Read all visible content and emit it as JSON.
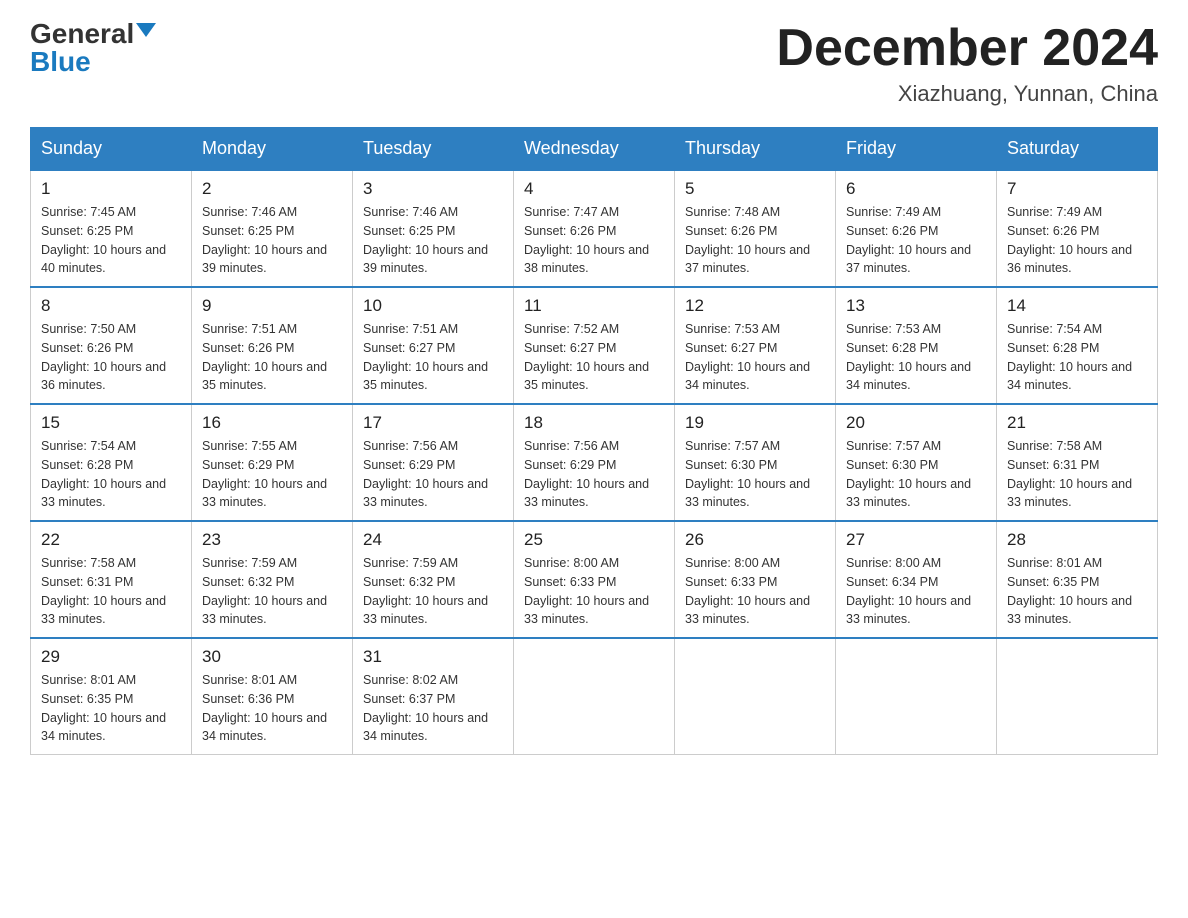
{
  "logo": {
    "general": "General",
    "blue": "Blue"
  },
  "title": "December 2024",
  "location": "Xiazhuang, Yunnan, China",
  "headers": [
    "Sunday",
    "Monday",
    "Tuesday",
    "Wednesday",
    "Thursday",
    "Friday",
    "Saturday"
  ],
  "weeks": [
    [
      {
        "day": "1",
        "sunrise": "7:45 AM",
        "sunset": "6:25 PM",
        "daylight": "10 hours and 40 minutes."
      },
      {
        "day": "2",
        "sunrise": "7:46 AM",
        "sunset": "6:25 PM",
        "daylight": "10 hours and 39 minutes."
      },
      {
        "day": "3",
        "sunrise": "7:46 AM",
        "sunset": "6:25 PM",
        "daylight": "10 hours and 39 minutes."
      },
      {
        "day": "4",
        "sunrise": "7:47 AM",
        "sunset": "6:26 PM",
        "daylight": "10 hours and 38 minutes."
      },
      {
        "day": "5",
        "sunrise": "7:48 AM",
        "sunset": "6:26 PM",
        "daylight": "10 hours and 37 minutes."
      },
      {
        "day": "6",
        "sunrise": "7:49 AM",
        "sunset": "6:26 PM",
        "daylight": "10 hours and 37 minutes."
      },
      {
        "day": "7",
        "sunrise": "7:49 AM",
        "sunset": "6:26 PM",
        "daylight": "10 hours and 36 minutes."
      }
    ],
    [
      {
        "day": "8",
        "sunrise": "7:50 AM",
        "sunset": "6:26 PM",
        "daylight": "10 hours and 36 minutes."
      },
      {
        "day": "9",
        "sunrise": "7:51 AM",
        "sunset": "6:26 PM",
        "daylight": "10 hours and 35 minutes."
      },
      {
        "day": "10",
        "sunrise": "7:51 AM",
        "sunset": "6:27 PM",
        "daylight": "10 hours and 35 minutes."
      },
      {
        "day": "11",
        "sunrise": "7:52 AM",
        "sunset": "6:27 PM",
        "daylight": "10 hours and 35 minutes."
      },
      {
        "day": "12",
        "sunrise": "7:53 AM",
        "sunset": "6:27 PM",
        "daylight": "10 hours and 34 minutes."
      },
      {
        "day": "13",
        "sunrise": "7:53 AM",
        "sunset": "6:28 PM",
        "daylight": "10 hours and 34 minutes."
      },
      {
        "day": "14",
        "sunrise": "7:54 AM",
        "sunset": "6:28 PM",
        "daylight": "10 hours and 34 minutes."
      }
    ],
    [
      {
        "day": "15",
        "sunrise": "7:54 AM",
        "sunset": "6:28 PM",
        "daylight": "10 hours and 33 minutes."
      },
      {
        "day": "16",
        "sunrise": "7:55 AM",
        "sunset": "6:29 PM",
        "daylight": "10 hours and 33 minutes."
      },
      {
        "day": "17",
        "sunrise": "7:56 AM",
        "sunset": "6:29 PM",
        "daylight": "10 hours and 33 minutes."
      },
      {
        "day": "18",
        "sunrise": "7:56 AM",
        "sunset": "6:29 PM",
        "daylight": "10 hours and 33 minutes."
      },
      {
        "day": "19",
        "sunrise": "7:57 AM",
        "sunset": "6:30 PM",
        "daylight": "10 hours and 33 minutes."
      },
      {
        "day": "20",
        "sunrise": "7:57 AM",
        "sunset": "6:30 PM",
        "daylight": "10 hours and 33 minutes."
      },
      {
        "day": "21",
        "sunrise": "7:58 AM",
        "sunset": "6:31 PM",
        "daylight": "10 hours and 33 minutes."
      }
    ],
    [
      {
        "day": "22",
        "sunrise": "7:58 AM",
        "sunset": "6:31 PM",
        "daylight": "10 hours and 33 minutes."
      },
      {
        "day": "23",
        "sunrise": "7:59 AM",
        "sunset": "6:32 PM",
        "daylight": "10 hours and 33 minutes."
      },
      {
        "day": "24",
        "sunrise": "7:59 AM",
        "sunset": "6:32 PM",
        "daylight": "10 hours and 33 minutes."
      },
      {
        "day": "25",
        "sunrise": "8:00 AM",
        "sunset": "6:33 PM",
        "daylight": "10 hours and 33 minutes."
      },
      {
        "day": "26",
        "sunrise": "8:00 AM",
        "sunset": "6:33 PM",
        "daylight": "10 hours and 33 minutes."
      },
      {
        "day": "27",
        "sunrise": "8:00 AM",
        "sunset": "6:34 PM",
        "daylight": "10 hours and 33 minutes."
      },
      {
        "day": "28",
        "sunrise": "8:01 AM",
        "sunset": "6:35 PM",
        "daylight": "10 hours and 33 minutes."
      }
    ],
    [
      {
        "day": "29",
        "sunrise": "8:01 AM",
        "sunset": "6:35 PM",
        "daylight": "10 hours and 34 minutes."
      },
      {
        "day": "30",
        "sunrise": "8:01 AM",
        "sunset": "6:36 PM",
        "daylight": "10 hours and 34 minutes."
      },
      {
        "day": "31",
        "sunrise": "8:02 AM",
        "sunset": "6:37 PM",
        "daylight": "10 hours and 34 minutes."
      },
      null,
      null,
      null,
      null
    ]
  ]
}
